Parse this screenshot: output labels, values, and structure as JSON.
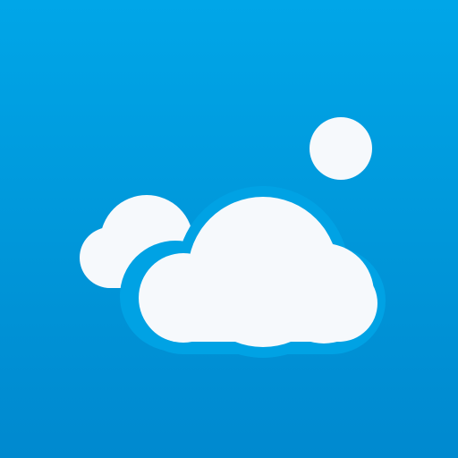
{
  "app_icon": {
    "name": "weather-app-icon",
    "icons": [
      "cloud-icon",
      "sun-icon"
    ],
    "colors": {
      "background_top": "#00a6e8",
      "background_bottom": "#0089cf",
      "shape_fill": "#f6f9fc"
    }
  }
}
